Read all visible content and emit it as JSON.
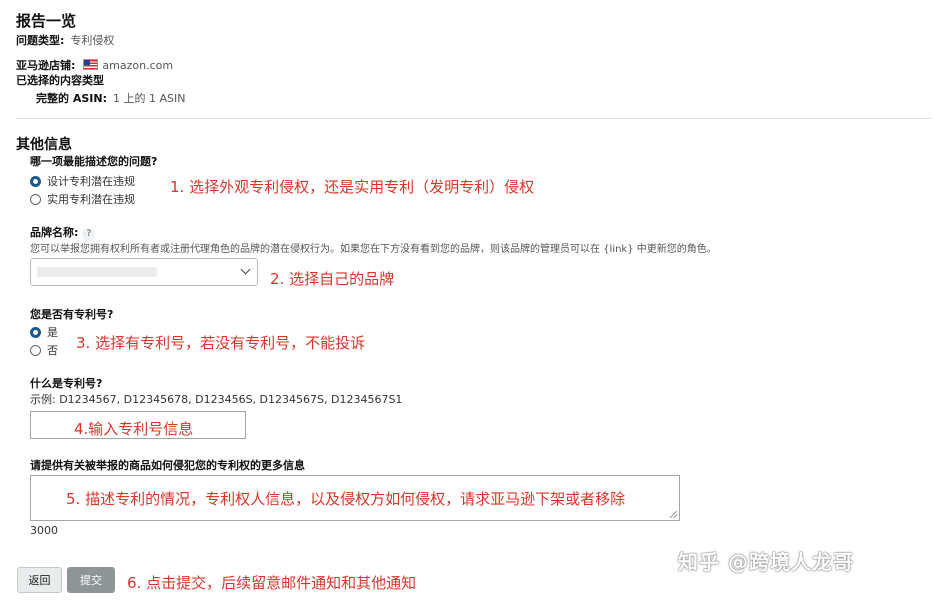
{
  "header": {
    "title": "报告一览",
    "issue_type_label": "问题类型:",
    "issue_type_value": "专利侵权",
    "store_label": "亚马逊店铺:",
    "store_value": "amazon.com",
    "content_type_label": "已选择的内容类型",
    "asin_label": "完整的 ASIN:",
    "asin_value": "1 上的 1 ASIN"
  },
  "section": {
    "title": "其他信息"
  },
  "q1": {
    "label": "哪一项最能描述您的问题?",
    "options": [
      {
        "label": "设计专利潜在违规",
        "selected": true
      },
      {
        "label": "实用专利潜在违规",
        "selected": false
      }
    ],
    "annotation": "1. 选择外观专利侵权，还是实用专利（发明专利）侵权"
  },
  "brand": {
    "label": "品牌名称:",
    "help": "?",
    "description": "您可以举报您拥有权利所有者或注册代理角色的品牌的潜在侵权行为。如果您在下方没有看到您的品牌，则该品牌的管理员可以在 {link} 中更新您的角色。",
    "annotation": "2. 选择自己的品牌"
  },
  "patent_q": {
    "label": "您是否有专利号?",
    "options": [
      {
        "label": "是",
        "selected": true
      },
      {
        "label": "否",
        "selected": false
      }
    ],
    "annotation": "3. 选择有专利号，若没有专利号，不能投诉"
  },
  "patent_number": {
    "label": "什么是专利号?",
    "example": "示例: D1234567, D12345678, D123456S, D1234567S, D1234567S1",
    "annotation": "4.输入专利号信息"
  },
  "details": {
    "label": "请提供有关被举报的商品如何侵犯您的专利权的更多信息",
    "annotation": "5. 描述专利的情况，专利权人信息，以及侵权方如何侵权，请求亚马逊下架或者移除",
    "char_limit": "3000"
  },
  "actions": {
    "back_label": "返回",
    "submit_label": "提交",
    "annotation": "6. 点击提交，后续留意邮件通知和其他通知"
  },
  "watermark": "知乎 @跨境人龙哥",
  "colors": {
    "annotation": "#d9362b",
    "radio_selected": "#1a5a8a",
    "submit_bg": "#8e9596"
  }
}
